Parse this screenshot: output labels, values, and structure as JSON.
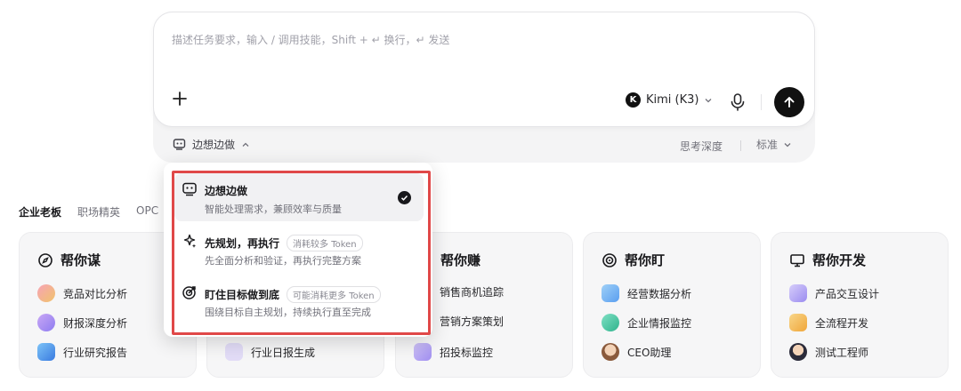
{
  "composer": {
    "placeholder": "描述任务要求，输入 / 调用技能，Shift + ↵ 换行，↵ 发送",
    "model_badge": "K",
    "model_label": "Kimi (K3)",
    "mode_label": "边想边做",
    "depth_label": "思考深度",
    "depth_value": "标准"
  },
  "dropdown": {
    "options": [
      {
        "title": "边想边做",
        "tag": "",
        "desc": "智能处理需求，兼顾效率与质量",
        "selected": true
      },
      {
        "title": "先规划，再执行",
        "tag": "消耗较多 Token",
        "desc": "先全面分析和验证，再执行完整方案",
        "selected": false
      },
      {
        "title": "盯住目标做到底",
        "tag": "可能消耗更多 Token",
        "desc": "围绕目标自主规划，持续执行直至完成",
        "selected": false
      }
    ]
  },
  "tabs": [
    "企业老板",
    "职场精英",
    "OPC"
  ],
  "cards": [
    {
      "title": "帮你谋",
      "items": [
        "竞品对比分析",
        "财报深度分析",
        "行业研究报告"
      ]
    },
    {
      "title": "",
      "items": [
        "",
        "",
        "行业日报生成"
      ]
    },
    {
      "title": "帮你赚",
      "items": [
        "销售商机追踪",
        "营销方案策划",
        "招投标监控"
      ]
    },
    {
      "title": "帮你盯",
      "items": [
        "经营数据分析",
        "企业情报监控",
        "CEO助理"
      ]
    },
    {
      "title": "帮你开发",
      "items": [
        "产品交互设计",
        "全流程开发",
        "测试工程师"
      ]
    }
  ],
  "colors": {
    "highlight": "#e04848",
    "send": "#111111"
  }
}
